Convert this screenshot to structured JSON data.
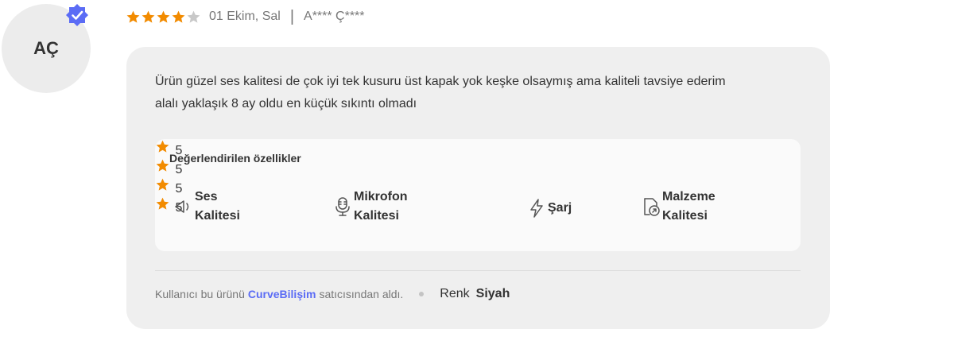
{
  "reviewer": {
    "initials": "AÇ",
    "verified": true,
    "name": "A**** Ç****"
  },
  "review": {
    "rating": 4,
    "max_rating": 5,
    "date": "01 Ekim, Sal",
    "text_line1": "Ürün güzel ses kalitesi de çok iyi tek kusuru üst kapak yok keşke olsaymış ama kaliteli tavsiye ederim",
    "text_line2": "alalı yaklaşık 8 ay oldu en küçük sıkıntı olmadı"
  },
  "features": {
    "title": "Değerlendirilen özellikler",
    "items": [
      {
        "icon": "speaker-icon",
        "label_line1": "Ses",
        "label_line2": "Kalitesi",
        "rating": "5"
      },
      {
        "icon": "microphone-icon",
        "label_line1": "Mikrofon",
        "label_line2": "Kalitesi",
        "rating": "5"
      },
      {
        "icon": "lightning-icon",
        "label_line1": "Şarj",
        "label_line2": "",
        "rating": "5"
      },
      {
        "icon": "material-icon",
        "label_line1": "Malzeme",
        "label_line2": "Kalitesi",
        "rating": "5"
      }
    ]
  },
  "seller": {
    "prefix": "Kullanıcı bu ürünü",
    "name": "CurveBilişim",
    "suffix": "satıcısından aldı."
  },
  "attribute": {
    "key": "Renk",
    "value": "Siyah"
  },
  "colors": {
    "star": "#f28b00",
    "star_empty": "#c8c8c8",
    "accent": "#5b6cf5",
    "badge": "#5b6cf5"
  }
}
